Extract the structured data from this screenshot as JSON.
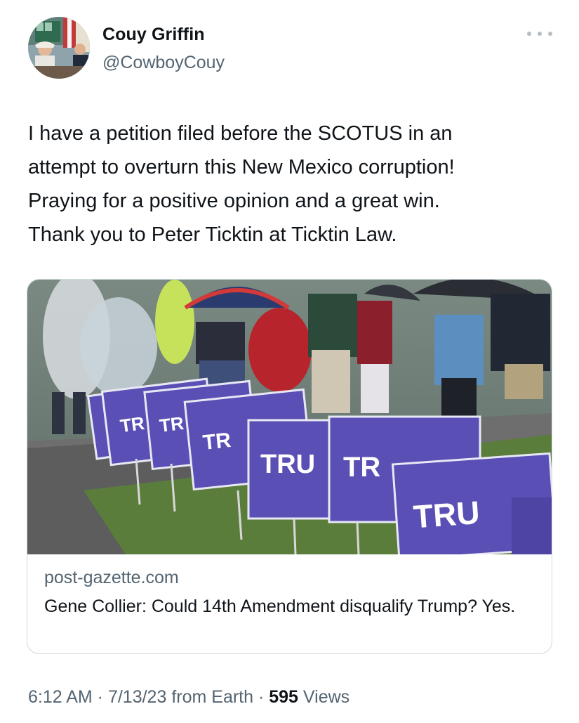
{
  "author": {
    "name": "Couy Griffin",
    "handle": "@CowboyCouy"
  },
  "tweet": {
    "text_lines": [
      "I have a petition filed before the SCOTUS in an",
      "attempt to overturn this New Mexico corruption!",
      "Praying for a positive opinion and a great win.",
      "Thank you to Peter Ticktin at Ticktin Law."
    ]
  },
  "card": {
    "domain": "post-gazette.com",
    "title": "Gene Collier: Could 14th Amendment disqualify Trump? Yes.",
    "image_sign_texts": [
      "TR",
      "TR",
      "TR",
      "TRU",
      "TR",
      "TRU"
    ]
  },
  "meta": {
    "time": "6:12 AM",
    "date": "7/13/23",
    "source": "from Earth",
    "separator": " · ",
    "views_count": "595",
    "views_label": "Views"
  },
  "icons": {
    "more": "more-horizontal-icon"
  },
  "colors": {
    "text_primary": "#0f1419",
    "text_secondary": "#536471",
    "border": "#cfd9de",
    "sign_blue": "#5a4fb5"
  }
}
